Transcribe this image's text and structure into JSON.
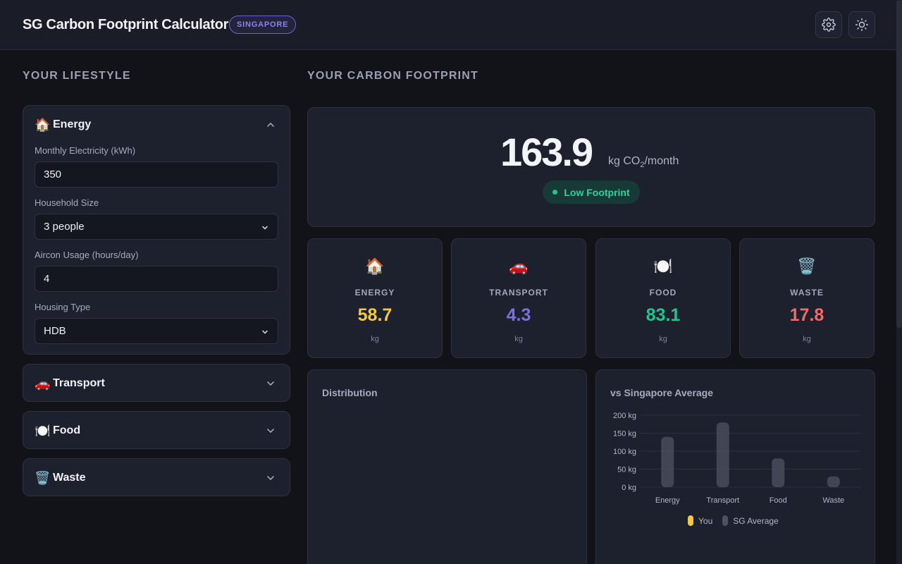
{
  "header": {
    "title": "SG Carbon Footprint Calculator",
    "badge": "SINGAPORE",
    "settings_icon": "gear-icon",
    "theme_icon": "sun-icon"
  },
  "left": {
    "section_title": "YOUR LIFESTYLE",
    "energy": {
      "title": "Energy",
      "emoji": "🏠",
      "fields": {
        "electricity_label": "Monthly Electricity (kWh)",
        "electricity_value": "350",
        "household_label": "Household Size",
        "household_value": "3 people",
        "aircon_label": "Aircon Usage (hours/day)",
        "aircon_value": "4",
        "housing_label": "Housing Type",
        "housing_value": "HDB"
      }
    },
    "transport": {
      "title": "Transport",
      "emoji": "🚗"
    },
    "food": {
      "title": "Food",
      "emoji": "🍽️"
    },
    "waste": {
      "title": "Waste",
      "emoji": "🗑️"
    }
  },
  "right": {
    "section_title": "YOUR CARBON FOOTPRINT",
    "total": {
      "value": "163.9",
      "unit_prefix": "kg CO",
      "unit_sub": "2",
      "unit_suffix": "/month",
      "status": "Low Footprint"
    },
    "stats": [
      {
        "emoji": "🏠",
        "label": "ENERGY",
        "value": "58.7",
        "unit": "kg",
        "color": "#f5c842"
      },
      {
        "emoji": "🚗",
        "label": "TRANSPORT",
        "value": "4.3",
        "unit": "kg",
        "color": "#7c6fe4"
      },
      {
        "emoji": "🍽️",
        "label": "FOOD",
        "value": "83.1",
        "unit": "kg",
        "color": "#22c58f"
      },
      {
        "emoji": "🗑️",
        "label": "WASTE",
        "value": "17.8",
        "unit": "kg",
        "color": "#f06a6a"
      }
    ],
    "distribution_title": "Distribution",
    "comparison_title": "vs Singapore Average"
  },
  "colors": {
    "you": "#f5c842",
    "sg_average": "#4d5162"
  },
  "chart_data": {
    "type": "bar",
    "title": "vs Singapore Average",
    "categories": [
      "Energy",
      "Transport",
      "Food",
      "Waste"
    ],
    "y_ticks": [
      "200 kg",
      "150 kg",
      "100 kg",
      "50 kg",
      "0 kg"
    ],
    "ylim": [
      0,
      200
    ],
    "grid": true,
    "legend_position": "bottom",
    "series": [
      {
        "name": "You",
        "values": [
          0,
          0,
          0,
          0
        ]
      },
      {
        "name": "SG Average",
        "values": [
          140,
          180,
          80,
          30
        ]
      }
    ]
  }
}
